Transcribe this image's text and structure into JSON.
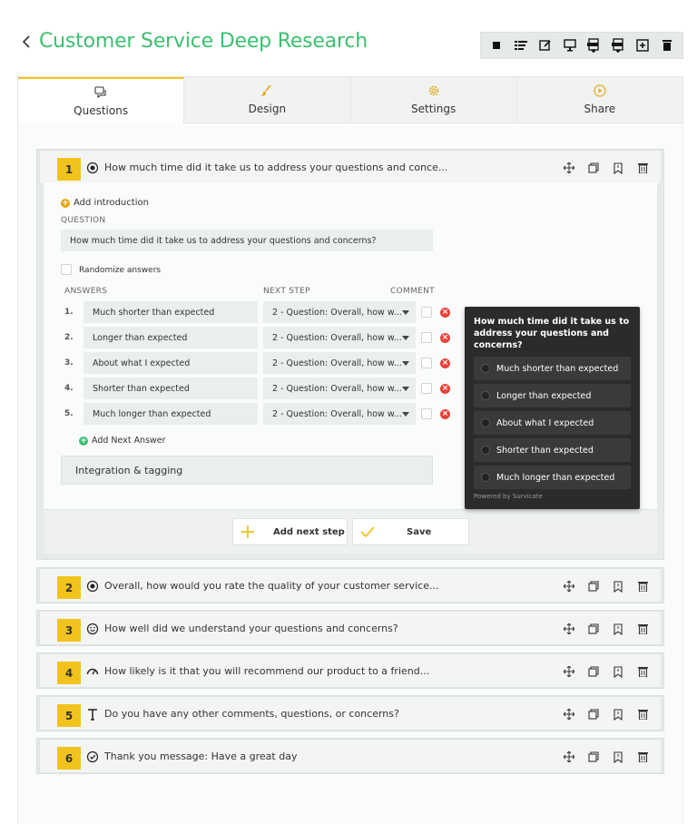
{
  "header": {
    "title": "Customer Service Deep Research"
  },
  "colors": {
    "accent_green": "#3cbf6f",
    "accent_yellow": "#f2c31d",
    "delete_red": "#e8423b"
  },
  "toolbar": {
    "icons": [
      "stop-icon",
      "list-icon",
      "edit-icon",
      "monitor-icon",
      "pdf-export-icon",
      "xls-export-icon",
      "duplicate-icon",
      "trash-icon"
    ]
  },
  "tabs": [
    {
      "label": "Questions",
      "icon": "chat-icon",
      "active": true
    },
    {
      "label": "Design",
      "icon": "brush-icon",
      "active": false
    },
    {
      "label": "Settings",
      "icon": "gear-icon",
      "active": false
    },
    {
      "label": "Share",
      "icon": "play-icon",
      "active": false
    }
  ],
  "editor": {
    "add_intro": "Add introduction",
    "question_label": "QUESTION",
    "question_value": "How much time did it take us to address your questions and concerns?",
    "randomize_label": "Randomize answers",
    "answers_header": "ANSWERS",
    "next_step_header": "NEXT STEP",
    "comment_header": "COMMENT",
    "answers": [
      {
        "num": "1.",
        "text": "Much shorter than expected",
        "next": "2 - Question: Overall, how w..."
      },
      {
        "num": "2.",
        "text": "Longer than expected",
        "next": "2 - Question: Overall, how w..."
      },
      {
        "num": "3.",
        "text": "About what I expected",
        "next": "2 - Question: Overall, how w..."
      },
      {
        "num": "4.",
        "text": "Shorter than expected",
        "next": "2 - Question: Overall, how w..."
      },
      {
        "num": "5.",
        "text": "Much longer than expected",
        "next": "2 - Question: Overall, how w..."
      }
    ],
    "add_answer": "Add Next Answer",
    "integration": "Integration & tagging",
    "add_next_step": "Add next step",
    "save": "Save"
  },
  "preview": {
    "title": "How much time did it take us to address your questions and concerns?",
    "options": [
      "Much shorter than expected",
      "Longer than expected",
      "About what I expected",
      "Shorter than expected",
      "Much longer than expected"
    ],
    "powered": "Powered by Survicate"
  },
  "questions": [
    {
      "num": "1",
      "type_icon": "radio-icon",
      "title": "How much time did it take us to address your questions and conce..."
    },
    {
      "num": "2",
      "type_icon": "radio-icon",
      "title": "Overall, how would you rate the quality of your customer service..."
    },
    {
      "num": "3",
      "type_icon": "smiley-icon",
      "title": "How well did we understand your questions and concerns?"
    },
    {
      "num": "4",
      "type_icon": "gauge-icon",
      "title": "How likely is it that you will recommend our product to a friend..."
    },
    {
      "num": "5",
      "type_icon": "text-icon",
      "title": "Do you have any other comments, questions, or concerns?"
    },
    {
      "num": "6",
      "type_icon": "check-circle-icon",
      "title": "Thank you message: Have a great day"
    }
  ]
}
